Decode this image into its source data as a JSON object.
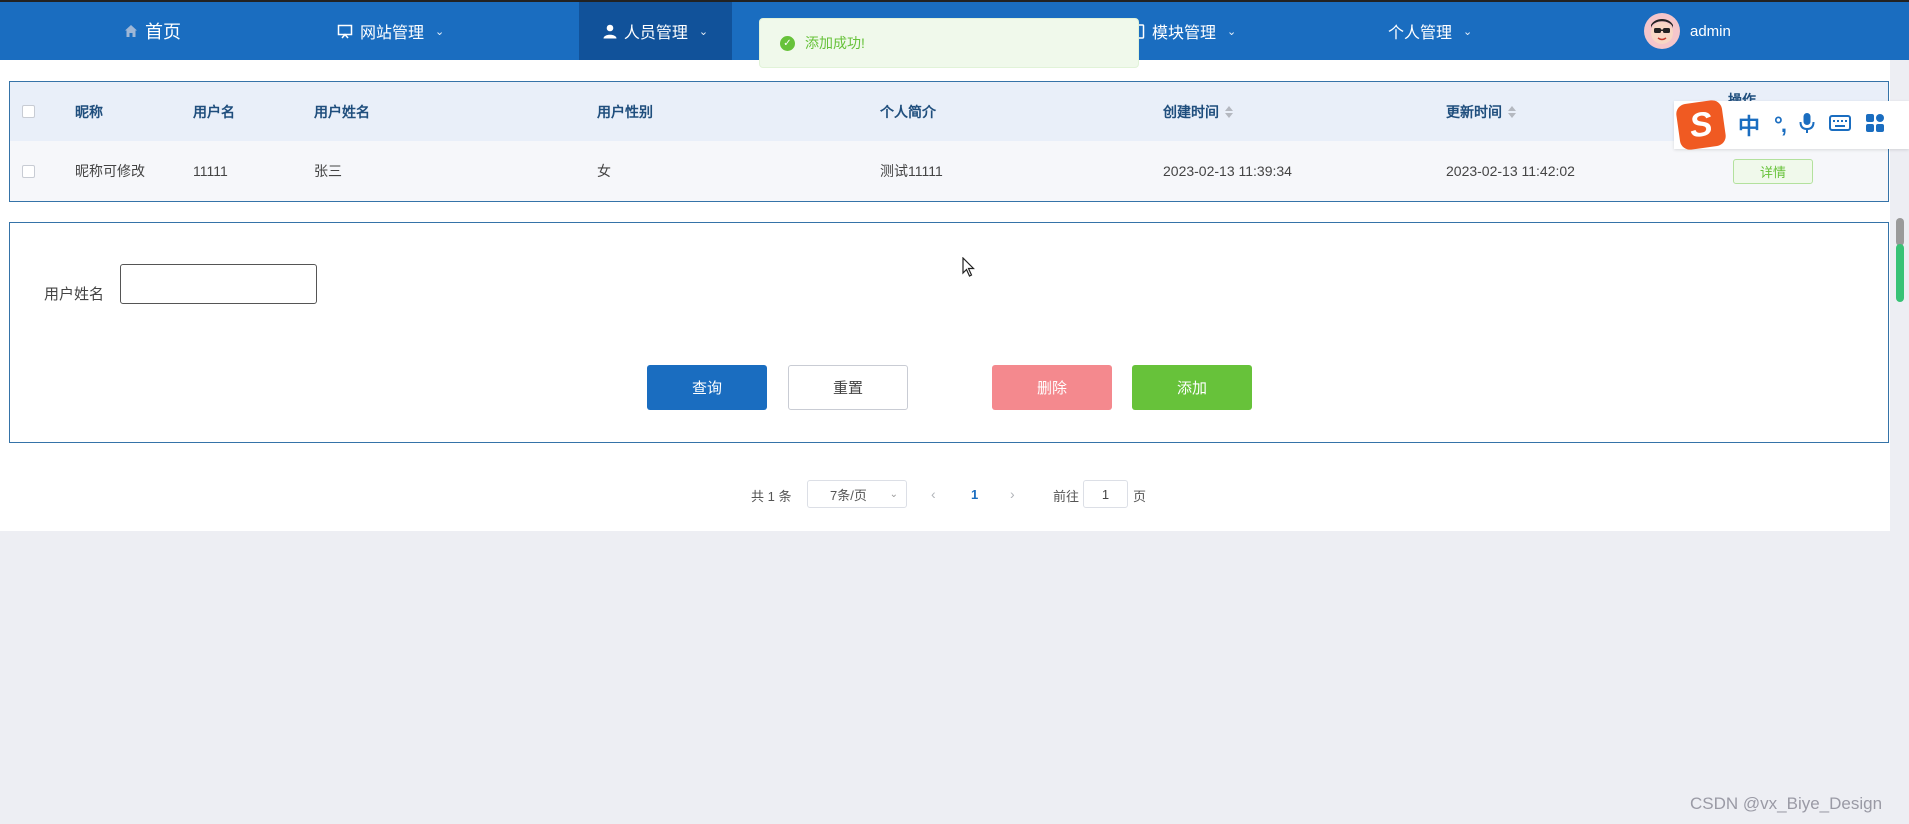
{
  "nav": {
    "home": "首页",
    "site_mgmt": "网站管理",
    "people_mgmt": "人员管理",
    "module_mgmt": "模块管理",
    "personal_mgmt": "个人管理",
    "user": "admin"
  },
  "toast": {
    "message": "添加成功!"
  },
  "table": {
    "headers": [
      "昵称",
      "用户名",
      "用户姓名",
      "用户性别",
      "个人简介",
      "创建时间",
      "更新时间",
      "操作"
    ],
    "rows": [
      {
        "nickname": "昵称可修改",
        "username": "11111",
        "realname": "张三",
        "gender": "女",
        "bio": "测试11111",
        "created": "2023-02-13 11:39:34",
        "updated": "2023-02-13 11:42:02",
        "action": "详情"
      }
    ]
  },
  "form": {
    "realname_label": "用户姓名",
    "realname_value": "",
    "query": "查询",
    "reset": "重置",
    "delete": "删除",
    "add": "添加"
  },
  "pagination": {
    "total": "共 1 条",
    "page_size": "7条/页",
    "current_page": "1",
    "goto_prefix": "前往",
    "goto_value": "1",
    "goto_suffix": "页"
  },
  "ime": {
    "mode": "中",
    "punct": "°,"
  },
  "watermark": "CSDN @vx_Biye_Design",
  "colors": {
    "nav_bg": "#1a6dc0",
    "nav_active": "#11529a",
    "success": "#67c23a",
    "danger_light": "#f4898e"
  }
}
